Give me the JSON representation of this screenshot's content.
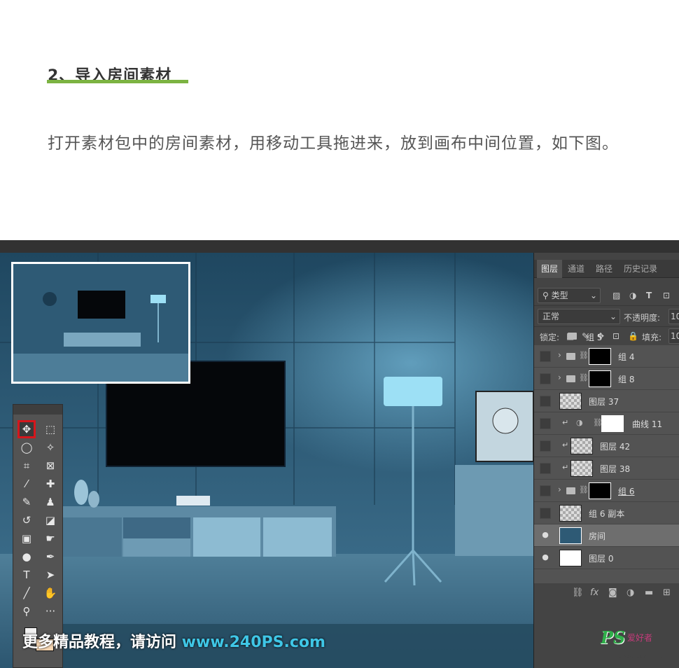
{
  "article": {
    "heading": "2、导入房间素材",
    "accent_color": "#7cb342",
    "paragraph": "打开素材包中的房间素材，用移动工具拖进来，放到画布中间位置，如下图。"
  },
  "watermark": {
    "prefix": "更多精品教程，请访问 ",
    "site": "www.240PS.com"
  },
  "logo": {
    "mark": "PS",
    "text": "爱好者",
    "url": "www.psahz.com"
  },
  "panel": {
    "tabs": [
      {
        "label": "图层",
        "active": true
      },
      {
        "label": "通道",
        "active": false
      },
      {
        "label": "路径",
        "active": false
      },
      {
        "label": "历史记录",
        "active": false
      }
    ],
    "filter_kind": "类型",
    "blend_mode": "正常",
    "opacity_label": "不透明度:",
    "opacity_value": "10",
    "lock_label": "锁定:",
    "fill_label": "填充:",
    "fill_value": "10",
    "partial_layer_name": "组 5",
    "layers": [
      {
        "name": "组 4",
        "type": "group",
        "visible": false,
        "selected": false
      },
      {
        "name": "组 8",
        "type": "group",
        "visible": false,
        "selected": false
      },
      {
        "name": "图层 37",
        "type": "layer",
        "visible": false,
        "selected": false
      },
      {
        "name": "曲线 11",
        "type": "adjustment",
        "visible": false,
        "selected": false
      },
      {
        "name": "图层 42",
        "type": "clipped",
        "visible": false,
        "selected": false
      },
      {
        "name": "图层 38",
        "type": "clipped",
        "visible": false,
        "selected": false
      },
      {
        "name": "组 6",
        "type": "group",
        "visible": false,
        "selected": false
      },
      {
        "name": "组 6 副本",
        "type": "layer",
        "visible": false,
        "selected": false
      },
      {
        "name": "房间",
        "type": "layer",
        "visible": true,
        "selected": true
      },
      {
        "name": "图层 0",
        "type": "layer",
        "visible": true,
        "selected": false
      }
    ]
  },
  "toolbox": {
    "tools": [
      {
        "name": "move-tool",
        "glyph": "✥",
        "active": true
      },
      {
        "name": "marquee-tool",
        "glyph": "⬚",
        "active": false
      },
      {
        "name": "lasso-tool",
        "glyph": "◯",
        "active": false
      },
      {
        "name": "magic-wand-tool",
        "glyph": "✧",
        "active": false
      },
      {
        "name": "crop-tool",
        "glyph": "⌗",
        "active": false
      },
      {
        "name": "frame-tool",
        "glyph": "⊠",
        "active": false
      },
      {
        "name": "eyedropper-tool",
        "glyph": "⁄",
        "active": false
      },
      {
        "name": "healing-brush-tool",
        "glyph": "✚",
        "active": false
      },
      {
        "name": "brush-tool",
        "glyph": "✎",
        "active": false
      },
      {
        "name": "clone-stamp-tool",
        "glyph": "♟",
        "active": false
      },
      {
        "name": "history-brush-tool",
        "glyph": "↺",
        "active": false
      },
      {
        "name": "eraser-tool",
        "glyph": "◪",
        "active": false
      },
      {
        "name": "gradient-tool",
        "glyph": "▣",
        "active": false
      },
      {
        "name": "smudge-tool",
        "glyph": "☛",
        "active": false
      },
      {
        "name": "dodge-tool",
        "glyph": "●",
        "active": false
      },
      {
        "name": "pen-tool",
        "glyph": "✒",
        "active": false
      },
      {
        "name": "type-tool",
        "glyph": "T",
        "active": false
      },
      {
        "name": "path-selection-tool",
        "glyph": "➤",
        "active": false
      },
      {
        "name": "line-tool",
        "glyph": "╱",
        "active": false
      },
      {
        "name": "hand-tool",
        "glyph": "✋",
        "active": false
      },
      {
        "name": "zoom-tool",
        "glyph": "⚲",
        "active": false
      },
      {
        "name": "more-tools",
        "glyph": "···",
        "active": false
      }
    ]
  },
  "colors": {
    "scene_wall": "#2f5b78",
    "highlight_red": "#d6161c",
    "watermark_site": "#3fc6e6"
  }
}
